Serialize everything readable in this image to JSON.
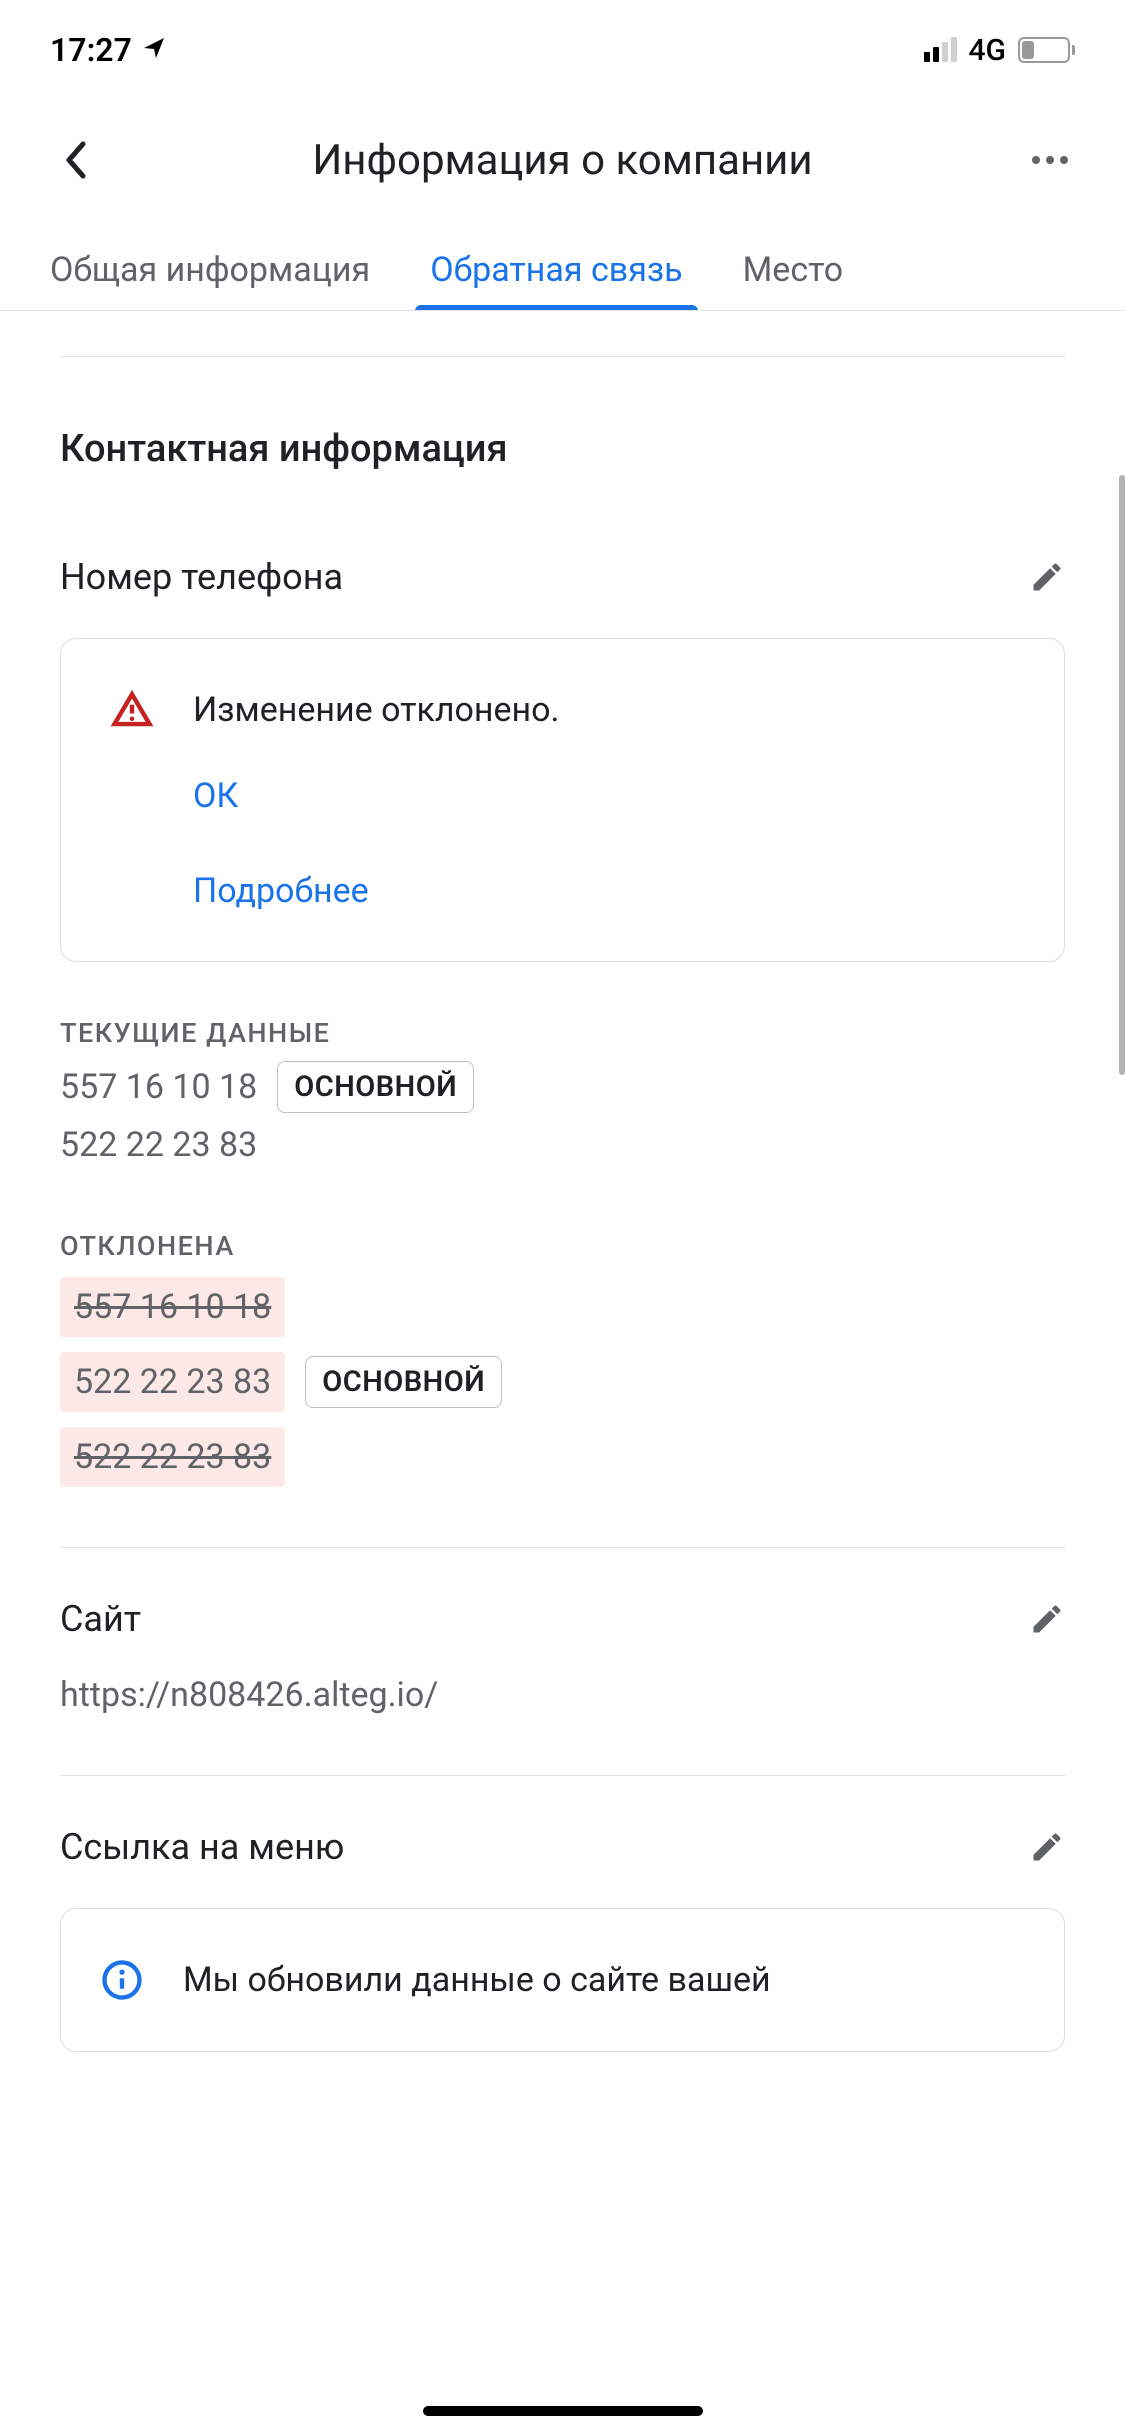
{
  "statusbar": {
    "time": "17:27",
    "network": "4G",
    "battery": "24"
  },
  "header": {
    "title": "Информация о компании"
  },
  "tabs": {
    "items": [
      {
        "label": "Общая информация"
      },
      {
        "label": "Обратная связь"
      },
      {
        "label": "Место"
      }
    ]
  },
  "section": {
    "title": "Контактная информация"
  },
  "phone": {
    "label": "Номер телефона"
  },
  "alert": {
    "message": "Изменение отклонено.",
    "ok": "ОК",
    "more": "Подробнее"
  },
  "current": {
    "label": "ТЕКУЩИЕ ДАННЫЕ",
    "phones": [
      {
        "number": "557 16 10 18",
        "primary": true
      },
      {
        "number": "522 22 23 83",
        "primary": false
      }
    ],
    "primary_badge": "ОСНОВНОЙ"
  },
  "rejected": {
    "label": "ОТКЛОНЕНА",
    "phones": [
      {
        "number": "557 16 10 18",
        "strike": true,
        "primary": false
      },
      {
        "number": "522 22 23 83",
        "strike": false,
        "primary": true
      },
      {
        "number": "522 22 23 83",
        "strike": true,
        "primary": false
      }
    ],
    "primary_badge": "ОСНОВНОЙ"
  },
  "site": {
    "label": "Сайт",
    "url": "https://n808426.alteg.io/"
  },
  "menu": {
    "label": "Ссылка на меню",
    "info_text": "Мы обновили данные о сайте вашей"
  }
}
